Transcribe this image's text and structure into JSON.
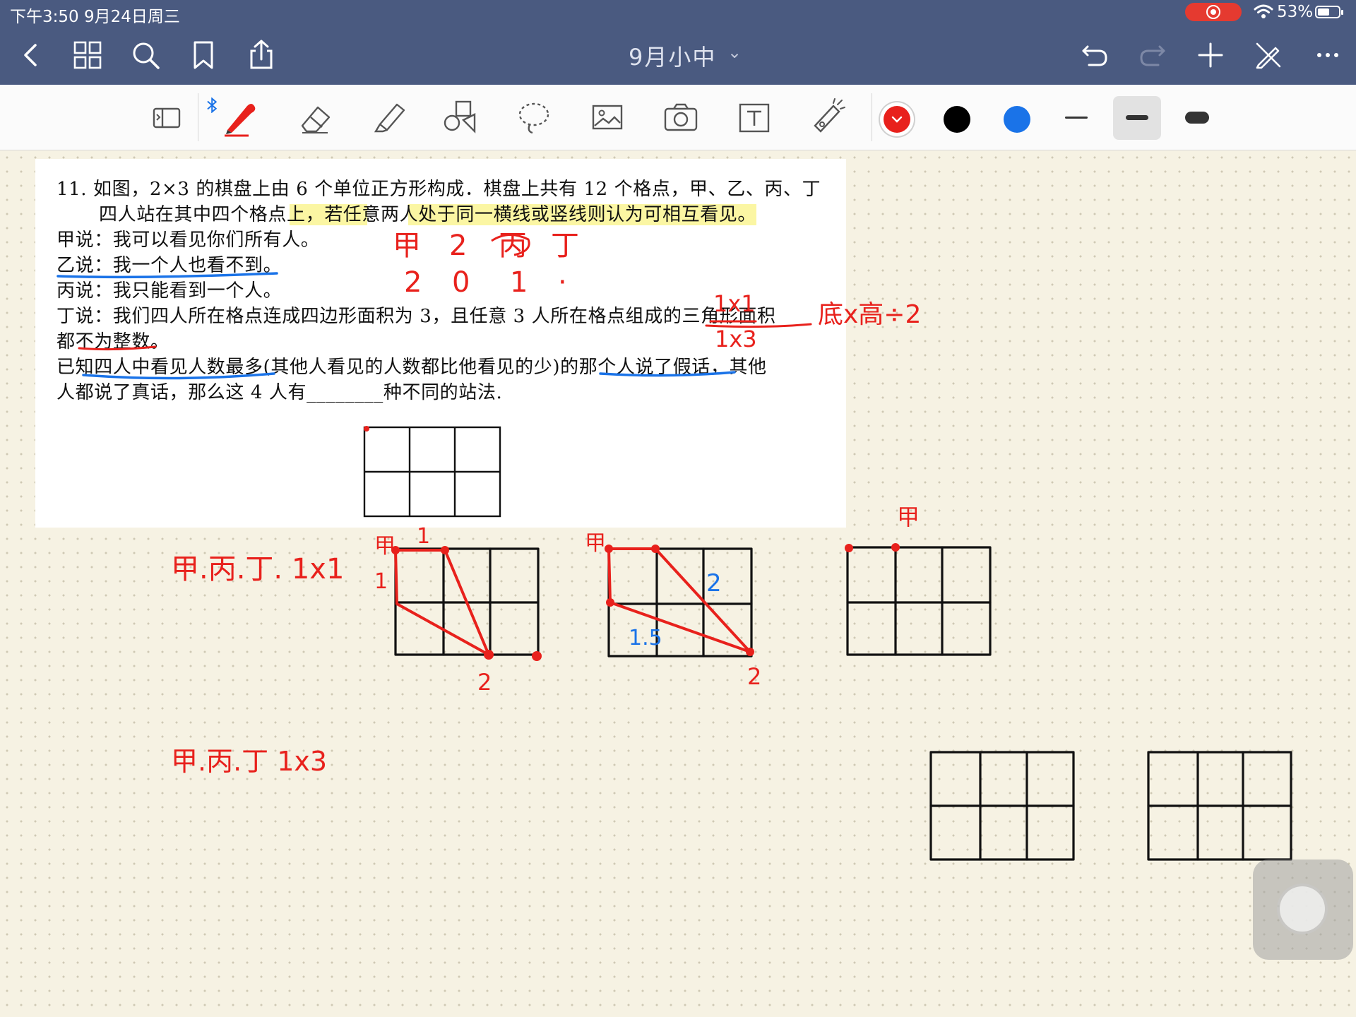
{
  "status_bar": {
    "time": "下午3:50  9月24日周三",
    "battery": "53%"
  },
  "nav": {
    "title": "9月小中"
  },
  "toolbar": {
    "colors": [
      "#e8211c",
      "#000000",
      "#1a73e8"
    ],
    "selected_color": "#e8211c"
  },
  "problem": {
    "line1": "11.   如图，2×3 的棋盘上由 6 个单位正方形构成．棋盘上共有 12 个格点，甲、乙、丙、丁",
    "line2": "四人站在其中四个格点上，若任意两人处于同一横线或竖线则认为可相互看见。",
    "line3": "甲说：我可以看见你们所有人。",
    "line4": "乙说：我一个人也看不到。",
    "line5": "丙说：我只能看到一个人。",
    "line6": "丁说：我们四人所在格点连成四边形面积为 3，且任意 3 人所在格点组成的三角形面积",
    "line7": "都不为整数。",
    "line8": "已知四人中看见人数最多(其他人看见的人数都比他看见的少)的那个人说了假话，其他",
    "line9": "人都说了真话，那么这 4 人有________种不同的站法."
  },
  "annotations": {
    "names_row": [
      "甲",
      "2",
      "丙",
      "丁"
    ],
    "counts_row": [
      "2",
      "0",
      "1",
      "·"
    ],
    "frac_top": "1x1",
    "frac_bottom": "1x3",
    "side_note": "底x高÷2",
    "case1_label": "甲.丙.丁.  1x1",
    "case2_label": "甲.丙.丁  1x3",
    "grid1_top": "1",
    "grid1_side": "1",
    "grid1_corner": "甲",
    "grid1_bottom": "2",
    "grid2_corner": "甲",
    "grid2_mid": "2",
    "grid2_blue": "1.5",
    "grid2_bottom": "2",
    "grid3_top": "甲"
  }
}
